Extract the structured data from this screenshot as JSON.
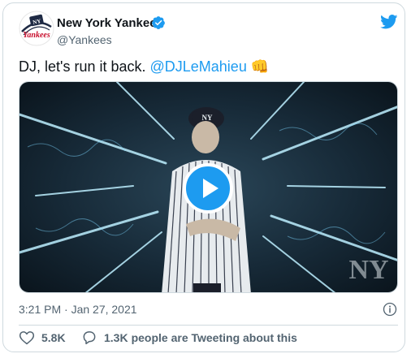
{
  "tweet": {
    "author": {
      "name": "New York Yankees",
      "handle": "@Yankees",
      "verified": true,
      "avatar_icon": "yankees-logo-icon"
    },
    "text_prefix": "DJ, let's run it back. ",
    "mention": "@DJLeMahieu",
    "emoji": "👊",
    "media": {
      "type": "video",
      "watermark": "NY",
      "play_icon": "play-icon"
    },
    "timestamp": "3:21 PM · Jan 27, 2021",
    "likes": "5.8K",
    "tweeting_count": "1.3K",
    "tweeting_label": "people are Tweeting about this"
  },
  "colors": {
    "accent": "#1d9bf0",
    "text": "#0f1419",
    "secondary": "#536471",
    "border": "#cfd9de",
    "yankees_red": "#c8102e"
  }
}
